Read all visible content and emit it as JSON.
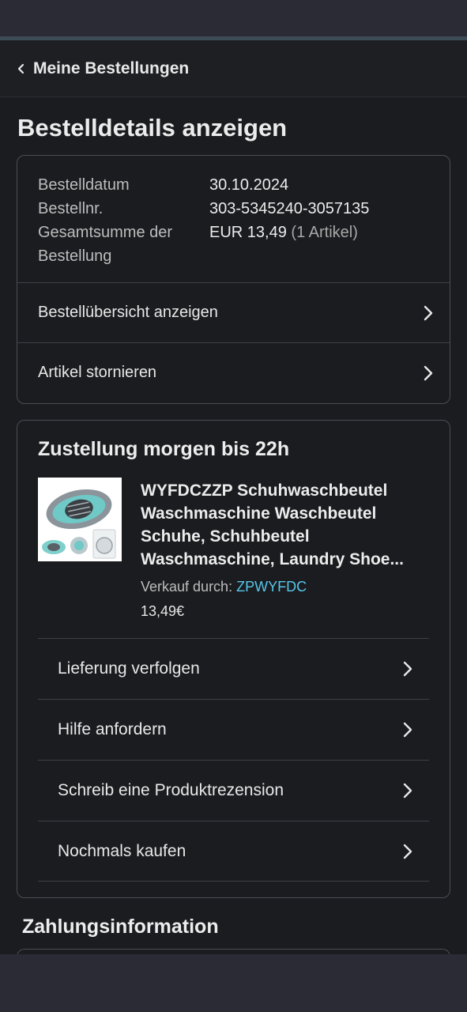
{
  "nav": {
    "back_label": "Meine Bestellungen"
  },
  "page": {
    "title": "Bestelldetails anzeigen"
  },
  "order": {
    "date_label": "Bestelldatum",
    "date_value": "30.10.2024",
    "number_label": "Bestellnr.",
    "number_value": "303-5345240-3057135",
    "total_label": "Gesamtsumme der Bestellung",
    "total_value": "EUR 13,49",
    "total_items": "(1 Artikel)"
  },
  "summary_links": [
    {
      "label": "Bestellübersicht anzeigen"
    },
    {
      "label": "Artikel stornieren"
    }
  ],
  "delivery": {
    "title": "Zustellung morgen bis 22h",
    "product_name": "WYFDCZZP Schuhwaschbeutel Waschmaschine Waschbeutel Schuhe, Schuhbeutel Waschmaschine, Laundry Shoe...",
    "seller_label": "Verkauf durch:",
    "seller_name": "ZPWYFDC",
    "price": "13,49€",
    "actions": [
      {
        "label": "Lieferung verfolgen"
      },
      {
        "label": "Hilfe anfordern"
      },
      {
        "label": "Schreib eine Produktrezension"
      },
      {
        "label": "Nochmals kaufen"
      }
    ]
  },
  "payment": {
    "title": "Zahlungsinformation"
  },
  "colors": {
    "background": "#1b1c20",
    "link": "#56c6ea",
    "border": "#4a4d54"
  }
}
